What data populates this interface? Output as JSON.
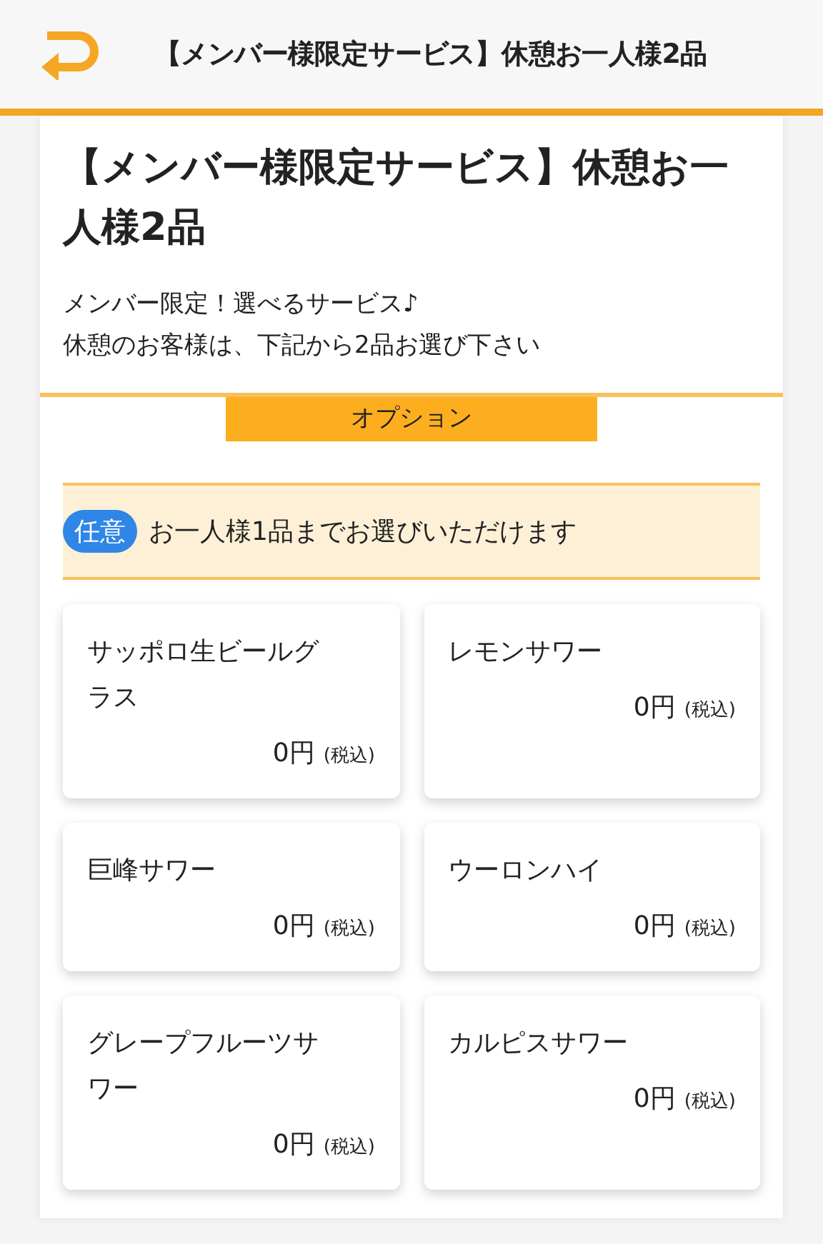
{
  "header": {
    "title": "【メンバー様限定サービス】休憩お一人様2品"
  },
  "plan": {
    "title": "【メンバー様限定サービス】休憩お一人様2品",
    "description": [
      "メンバー限定！選べるサービス♪",
      "休憩のお客様は、下記から2品お選び下さい"
    ]
  },
  "section": {
    "label": "オプション"
  },
  "notice": {
    "badge": "任意",
    "text": "お一人様1品までお選びいただけます"
  },
  "items": [
    {
      "name": "サッポロ生ビールグラス",
      "price": "0円",
      "tax": "(税込)"
    },
    {
      "name": "レモンサワー",
      "price": "0円",
      "tax": "(税込)"
    },
    {
      "name": "巨峰サワー",
      "price": "0円",
      "tax": "(税込)"
    },
    {
      "name": "ウーロンハイ",
      "price": "0円",
      "tax": "(税込)"
    },
    {
      "name": "グレープフルーツサワー",
      "price": "0円",
      "tax": "(税込)"
    },
    {
      "name": "カルピスサワー",
      "price": "0円",
      "tax": "(税込)"
    }
  ]
}
